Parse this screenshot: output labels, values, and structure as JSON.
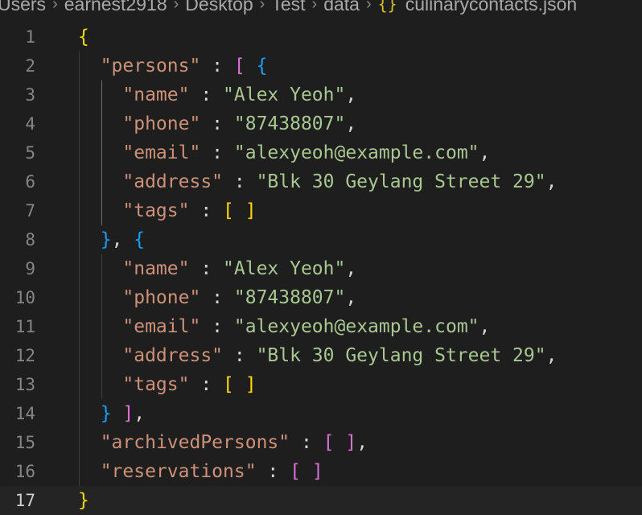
{
  "breadcrumb": {
    "items": [
      "Users",
      "earnest2918",
      "Desktop",
      "Test",
      "data"
    ],
    "file_icon": "{}",
    "file_name": "culinarycontacts.json"
  },
  "editor": {
    "current_line": 17,
    "lines": [
      {
        "n": "1",
        "tokens": [
          {
            "t": "{",
            "c": "brace-y"
          }
        ]
      },
      {
        "n": "2",
        "tokens": [
          {
            "t": "  ",
            "c": "punct"
          },
          {
            "t": "\"persons\"",
            "c": "key"
          },
          {
            "t": " : ",
            "c": "punct"
          },
          {
            "t": "[",
            "c": "brace-p"
          },
          {
            "t": " ",
            "c": "punct"
          },
          {
            "t": "{",
            "c": "brace-b"
          }
        ]
      },
      {
        "n": "3",
        "tokens": [
          {
            "t": "    ",
            "c": "punct"
          },
          {
            "t": "\"name\"",
            "c": "key"
          },
          {
            "t": " : ",
            "c": "punct"
          },
          {
            "t": "\"Alex Yeoh\"",
            "c": "str"
          },
          {
            "t": ",",
            "c": "punct"
          }
        ]
      },
      {
        "n": "4",
        "tokens": [
          {
            "t": "    ",
            "c": "punct"
          },
          {
            "t": "\"phone\"",
            "c": "key"
          },
          {
            "t": " : ",
            "c": "punct"
          },
          {
            "t": "\"87438807\"",
            "c": "str"
          },
          {
            "t": ",",
            "c": "punct"
          }
        ]
      },
      {
        "n": "5",
        "tokens": [
          {
            "t": "    ",
            "c": "punct"
          },
          {
            "t": "\"email\"",
            "c": "key"
          },
          {
            "t": " : ",
            "c": "punct"
          },
          {
            "t": "\"alexyeoh@example.com\"",
            "c": "str"
          },
          {
            "t": ",",
            "c": "punct"
          }
        ]
      },
      {
        "n": "6",
        "tokens": [
          {
            "t": "    ",
            "c": "punct"
          },
          {
            "t": "\"address\"",
            "c": "key"
          },
          {
            "t": " : ",
            "c": "punct"
          },
          {
            "t": "\"Blk 30 Geylang Street 29\"",
            "c": "str"
          },
          {
            "t": ",",
            "c": "punct"
          }
        ]
      },
      {
        "n": "7",
        "tokens": [
          {
            "t": "    ",
            "c": "punct"
          },
          {
            "t": "\"tags\"",
            "c": "key"
          },
          {
            "t": " : ",
            "c": "punct"
          },
          {
            "t": "[ ]",
            "c": "brace-y"
          }
        ]
      },
      {
        "n": "8",
        "tokens": [
          {
            "t": "  ",
            "c": "punct"
          },
          {
            "t": "}",
            "c": "brace-b"
          },
          {
            "t": ", ",
            "c": "punct"
          },
          {
            "t": "{",
            "c": "brace-b"
          }
        ]
      },
      {
        "n": "9",
        "tokens": [
          {
            "t": "    ",
            "c": "punct"
          },
          {
            "t": "\"name\"",
            "c": "key"
          },
          {
            "t": " : ",
            "c": "punct"
          },
          {
            "t": "\"Alex Yeoh\"",
            "c": "str"
          },
          {
            "t": ",",
            "c": "punct"
          }
        ]
      },
      {
        "n": "10",
        "tokens": [
          {
            "t": "    ",
            "c": "punct"
          },
          {
            "t": "\"phone\"",
            "c": "key"
          },
          {
            "t": " : ",
            "c": "punct"
          },
          {
            "t": "\"87438807\"",
            "c": "str"
          },
          {
            "t": ",",
            "c": "punct"
          }
        ]
      },
      {
        "n": "11",
        "tokens": [
          {
            "t": "    ",
            "c": "punct"
          },
          {
            "t": "\"email\"",
            "c": "key"
          },
          {
            "t": " : ",
            "c": "punct"
          },
          {
            "t": "\"alexyeoh@example.com\"",
            "c": "str"
          },
          {
            "t": ",",
            "c": "punct"
          }
        ]
      },
      {
        "n": "12",
        "tokens": [
          {
            "t": "    ",
            "c": "punct"
          },
          {
            "t": "\"address\"",
            "c": "key"
          },
          {
            "t": " : ",
            "c": "punct"
          },
          {
            "t": "\"Blk 30 Geylang Street 29\"",
            "c": "str"
          },
          {
            "t": ",",
            "c": "punct"
          }
        ]
      },
      {
        "n": "13",
        "tokens": [
          {
            "t": "    ",
            "c": "punct"
          },
          {
            "t": "\"tags\"",
            "c": "key"
          },
          {
            "t": " : ",
            "c": "punct"
          },
          {
            "t": "[ ]",
            "c": "brace-y"
          }
        ]
      },
      {
        "n": "14",
        "tokens": [
          {
            "t": "  ",
            "c": "punct"
          },
          {
            "t": "}",
            "c": "brace-b"
          },
          {
            "t": " ",
            "c": "punct"
          },
          {
            "t": "]",
            "c": "brace-p"
          },
          {
            "t": ",",
            "c": "punct"
          }
        ]
      },
      {
        "n": "15",
        "tokens": [
          {
            "t": "  ",
            "c": "punct"
          },
          {
            "t": "\"archivedPersons\"",
            "c": "key"
          },
          {
            "t": " : ",
            "c": "punct"
          },
          {
            "t": "[ ]",
            "c": "brace-p"
          },
          {
            "t": ",",
            "c": "punct"
          }
        ]
      },
      {
        "n": "16",
        "tokens": [
          {
            "t": "  ",
            "c": "punct"
          },
          {
            "t": "\"reservations\"",
            "c": "key"
          },
          {
            "t": " : ",
            "c": "punct"
          },
          {
            "t": "[ ]",
            "c": "brace-p"
          }
        ]
      },
      {
        "n": "17",
        "tokens": [
          {
            "t": "}",
            "c": "brace-y"
          }
        ]
      }
    ]
  },
  "colors": {
    "background": "#1e1e1e",
    "key": "#ce9178",
    "string": "#a8c890",
    "brace_level1": "#ffd700",
    "brace_level2": "#da70d6",
    "brace_level3": "#179fff",
    "line_number": "#858585"
  }
}
